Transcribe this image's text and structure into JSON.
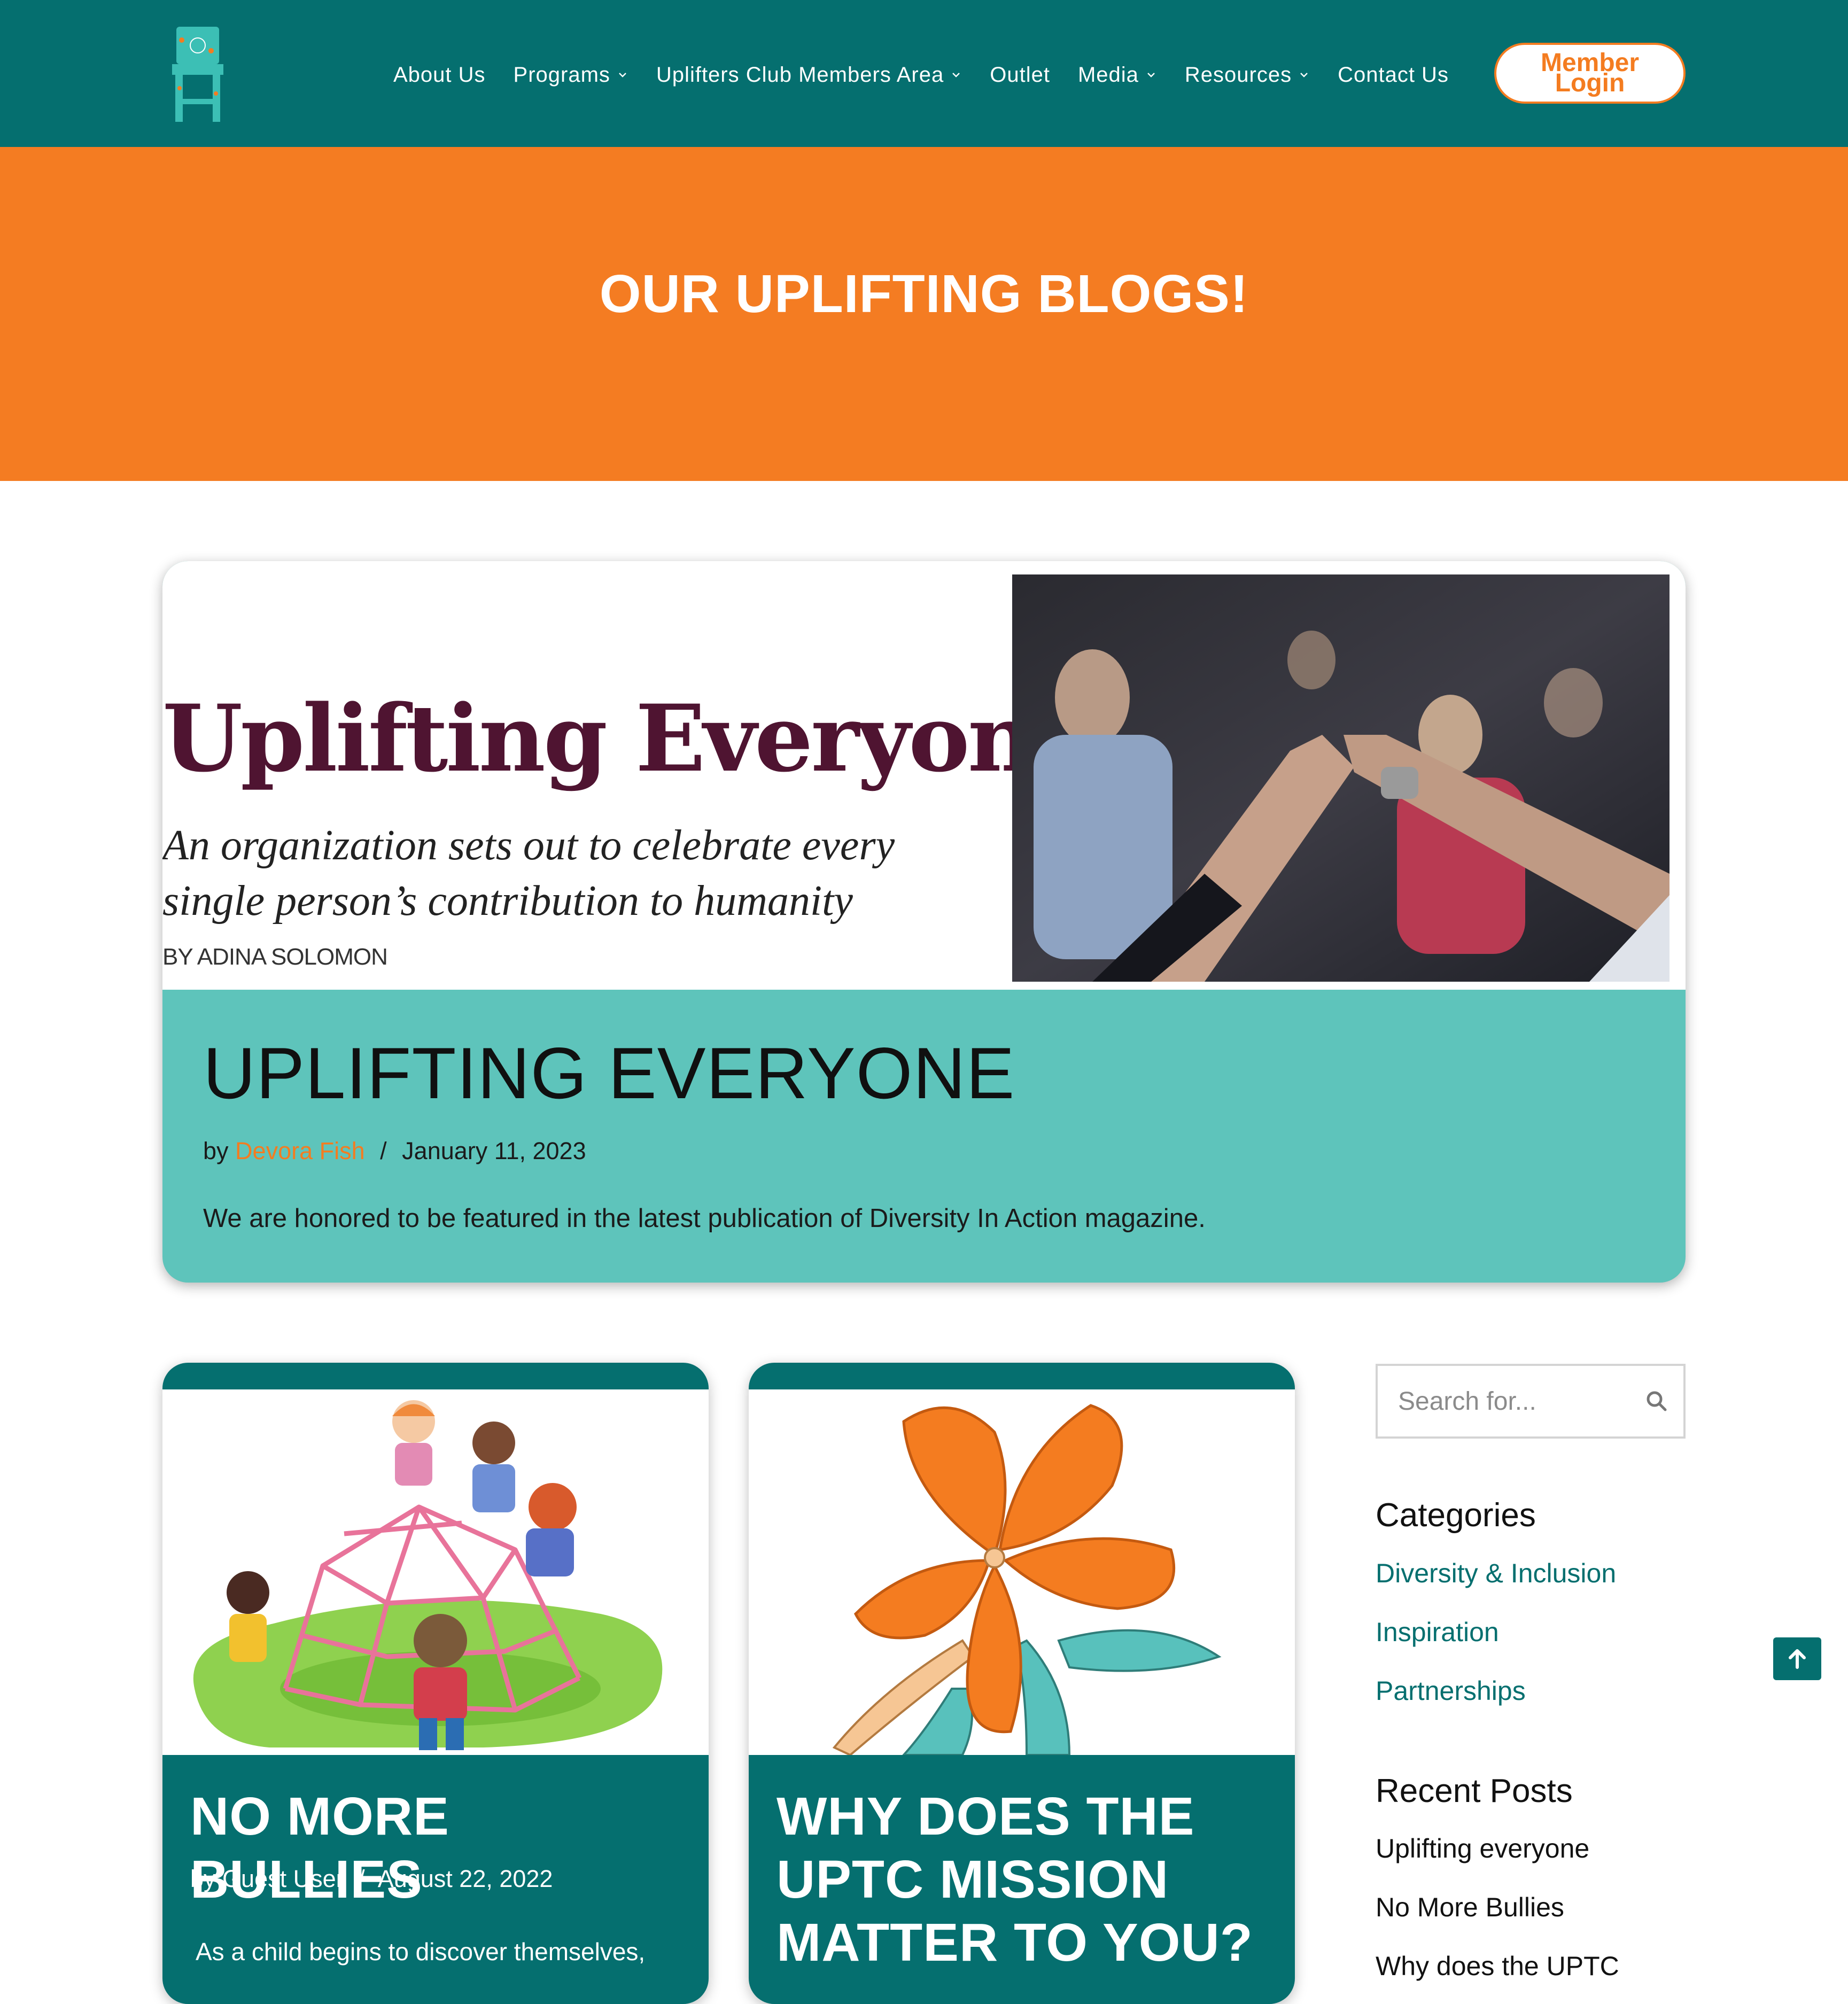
{
  "header": {
    "logo_alt": "Each & Every logo",
    "nav": [
      {
        "label": "About Us",
        "has_dropdown": false
      },
      {
        "label": "Programs",
        "has_dropdown": true
      },
      {
        "label": "Uplifters Club Members Area",
        "has_dropdown": true
      },
      {
        "label": "Outlet",
        "has_dropdown": false
      },
      {
        "label": "Media",
        "has_dropdown": true
      },
      {
        "label": "Resources",
        "has_dropdown": true
      },
      {
        "label": "Contact Us",
        "has_dropdown": false
      }
    ],
    "member_login": {
      "line1": "Member",
      "line2": "Login"
    }
  },
  "hero": {
    "title": "OUR UPLIFTING BLOGS!"
  },
  "featured_post": {
    "image_text": {
      "headline": "Uplifting Everyone",
      "subtitle": "An organization sets out to celebrate every single person’s contribution to humanity",
      "byline": "BY ADINA SOLOMON"
    },
    "title": "UPLIFTING EVERYONE",
    "by": "by",
    "author": "Devora Fish",
    "separator": "/",
    "date": "January 11, 2023",
    "excerpt": "We are honored to be featured in the latest publication of Diversity In Action magazine."
  },
  "posts": [
    {
      "title": "NO MORE BULLIES",
      "by": "by",
      "author": "Guest User",
      "separator": "/",
      "date": "August 22, 2022",
      "excerpt": "As a child begins to discover themselves,"
    },
    {
      "title": "WHY DOES THE UPTC MISSION MATTER TO YOU?"
    }
  ],
  "sidebar": {
    "search_placeholder": "Search for...",
    "categories_title": "Categories",
    "categories": [
      "Diversity & Inclusion",
      "Inspiration",
      "Partnerships"
    ],
    "recent_title": "Recent Posts",
    "recent_posts": [
      "Uplifting everyone",
      "No More Bullies",
      "Why does the UPTC"
    ]
  },
  "colors": {
    "teal_dark": "#056f6f",
    "teal_light": "#5ec4bb",
    "orange": "#f47c22",
    "white": "#ffffff"
  },
  "icons": {
    "nav_dropdown": "chevron-down-icon",
    "search": "search-icon",
    "back_to_top": "arrow-up-icon"
  }
}
